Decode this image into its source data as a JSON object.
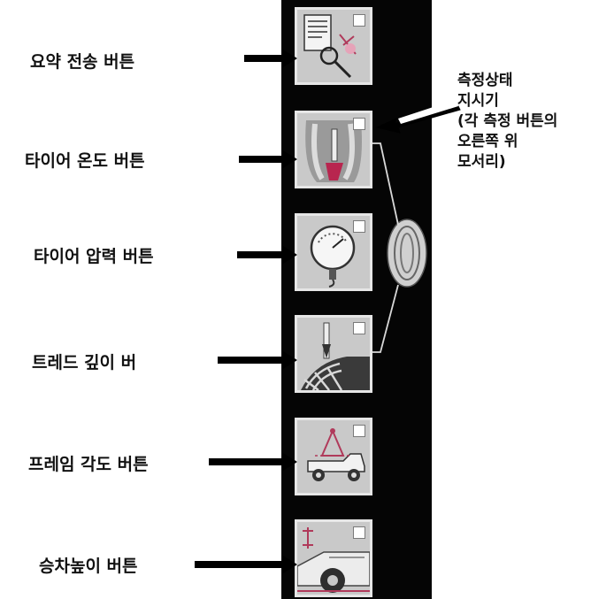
{
  "buttons": [
    {
      "label": "요약 전송 버튼",
      "icon": "summary-send-icon"
    },
    {
      "label": "타이어 온도 버튼",
      "icon": "tire-temperature-icon"
    },
    {
      "label": "타이어 압력 버튼",
      "icon": "tire-pressure-gauge-icon"
    },
    {
      "label": "트레드  깊이  버",
      "icon": "tread-depth-icon"
    },
    {
      "label": "프레임 각도 버튼",
      "icon": "frame-angle-icon"
    },
    {
      "label": "승차높이 버튼",
      "icon": "ride-height-icon"
    }
  ],
  "callout": {
    "lines": [
      "측정상태",
      "지시기",
      "(각 측정 버튼의",
      "오른쪽 위",
      "모서리)"
    ]
  },
  "colors": {
    "strip": "#050505",
    "button": "#c9c9c9",
    "arrow": "#000000"
  }
}
